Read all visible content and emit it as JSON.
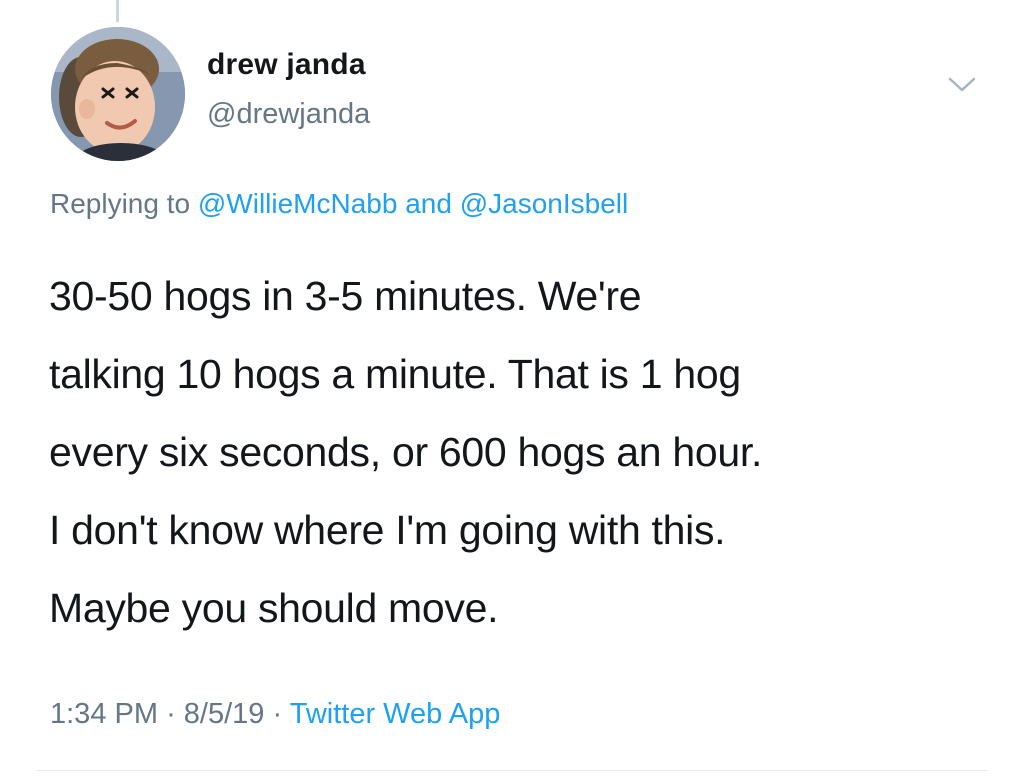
{
  "tweet": {
    "author": {
      "display_name": "drew janda",
      "handle": "@drewjanda"
    },
    "replying_to": {
      "prefix": "Replying to",
      "mention_1": "@WillieMcNabb",
      "conjunction": "and",
      "mention_2": "@JasonIsbell"
    },
    "text_lines": [
      "30-50 hogs in 3-5 minutes. We're",
      "talking 10 hogs a minute. That is 1 hog",
      "every six seconds, or 600 hogs an hour.",
      "I don't know where I'm going with this.",
      "Maybe you should move."
    ],
    "time": "1:34 PM",
    "separator": "·",
    "date": "8/5/19",
    "source": "Twitter Web App"
  },
  "colors": {
    "text": "#14171a",
    "secondary": "#657786",
    "link": "#1da1f2"
  },
  "icons": {
    "menu": "chevron-down-icon"
  }
}
